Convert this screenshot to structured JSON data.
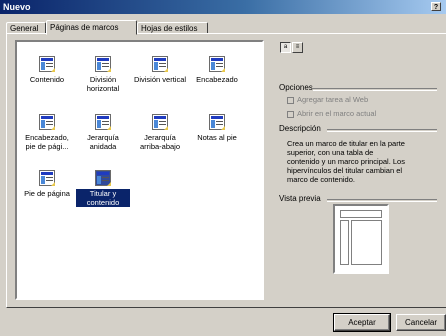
{
  "window": {
    "title": "Nuevo",
    "help_label": "?"
  },
  "tabs": [
    {
      "label": "General",
      "active": false
    },
    {
      "label": "Páginas de marcos",
      "active": true
    },
    {
      "label": "Hojas de estilos",
      "active": false
    }
  ],
  "templates": [
    {
      "label": "Contenido",
      "selected": false
    },
    {
      "label": "División horizontal",
      "selected": false
    },
    {
      "label": "División vertical",
      "selected": false
    },
    {
      "label": "Encabezado",
      "selected": false
    },
    {
      "label": "Encabezado, pie de pági...",
      "selected": false
    },
    {
      "label": "Jerarquía anidada",
      "selected": false
    },
    {
      "label": "Jerarquía arriba-abajo",
      "selected": false
    },
    {
      "label": "Notas al pie",
      "selected": false
    },
    {
      "label": "Pie de página",
      "selected": false
    },
    {
      "label": "Titular y contenido",
      "selected": true
    }
  ],
  "view_buttons": {
    "large_icons": "a",
    "list": "≡"
  },
  "options": {
    "heading": "Opciones",
    "add_task_label": "Agregar tarea al Web",
    "open_current_frame_label": "Abrir en el marco actual"
  },
  "description": {
    "heading": "Descripción",
    "text": "Crea un marco de titular en la parte superior, con una tabla de contenido y un marco principal. Los hipervínculos del titular cambian el marco de contenido."
  },
  "preview": {
    "heading": "Vista previa"
  },
  "buttons": {
    "accept": "Aceptar",
    "cancel": "Cancelar"
  }
}
